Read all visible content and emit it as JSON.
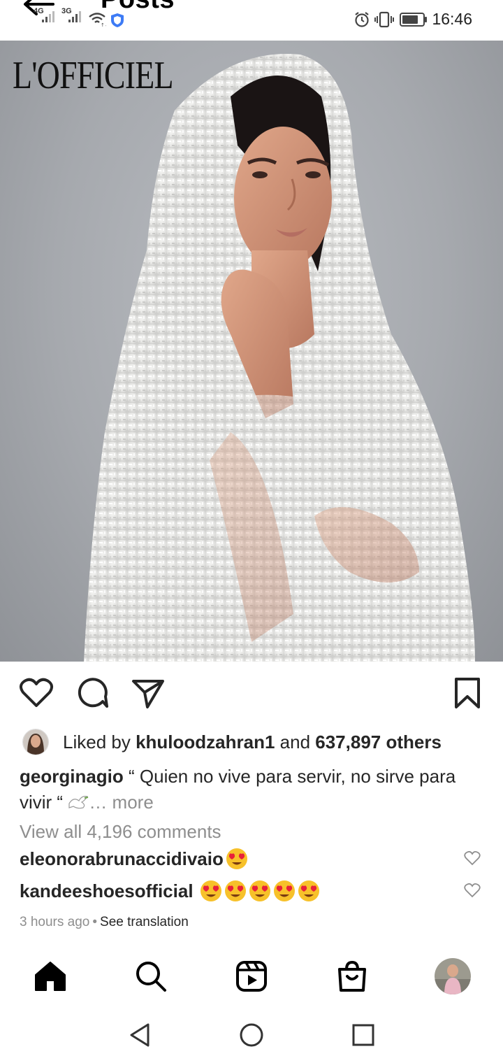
{
  "status_bar": {
    "title": "Posts",
    "sim1_label": "4G",
    "sim2_label": "3G",
    "time": "16:46"
  },
  "post": {
    "photo_brand": "L'OFFICIEL",
    "liked_prefix": "Liked by ",
    "liked_user": "khuloodzahran1",
    "liked_middle": " and ",
    "liked_count": "637,897 others",
    "caption_user": "georginagio",
    "caption_text": " “ Quien no vive para servir, no sirve para vivir “ ",
    "caption_more": "… more",
    "view_comments": "View all 4,196 comments",
    "comments": [
      {
        "user": "eleonorabrunaccidivaio",
        "emoji_count": 1
      },
      {
        "user": "kandeeshoesofficial",
        "emoji_count": 5
      }
    ],
    "time_ago": "3 hours ago",
    "separator": "•",
    "see_translation": "See translation"
  },
  "colors": {
    "text": "#262626",
    "muted": "#8e8e8e",
    "emoji_face": "#f7c12a",
    "emoji_heart": "#e8213a"
  },
  "icons": {
    "action_row": [
      "heart-icon",
      "comment-icon",
      "send-icon",
      "bookmark-icon"
    ],
    "bottom_nav": [
      "home-icon",
      "search-icon",
      "reels-icon",
      "shop-icon",
      "profile-avatar"
    ],
    "system_nav": [
      "back-triangle-icon",
      "home-circle-icon",
      "recents-square-icon"
    ]
  }
}
